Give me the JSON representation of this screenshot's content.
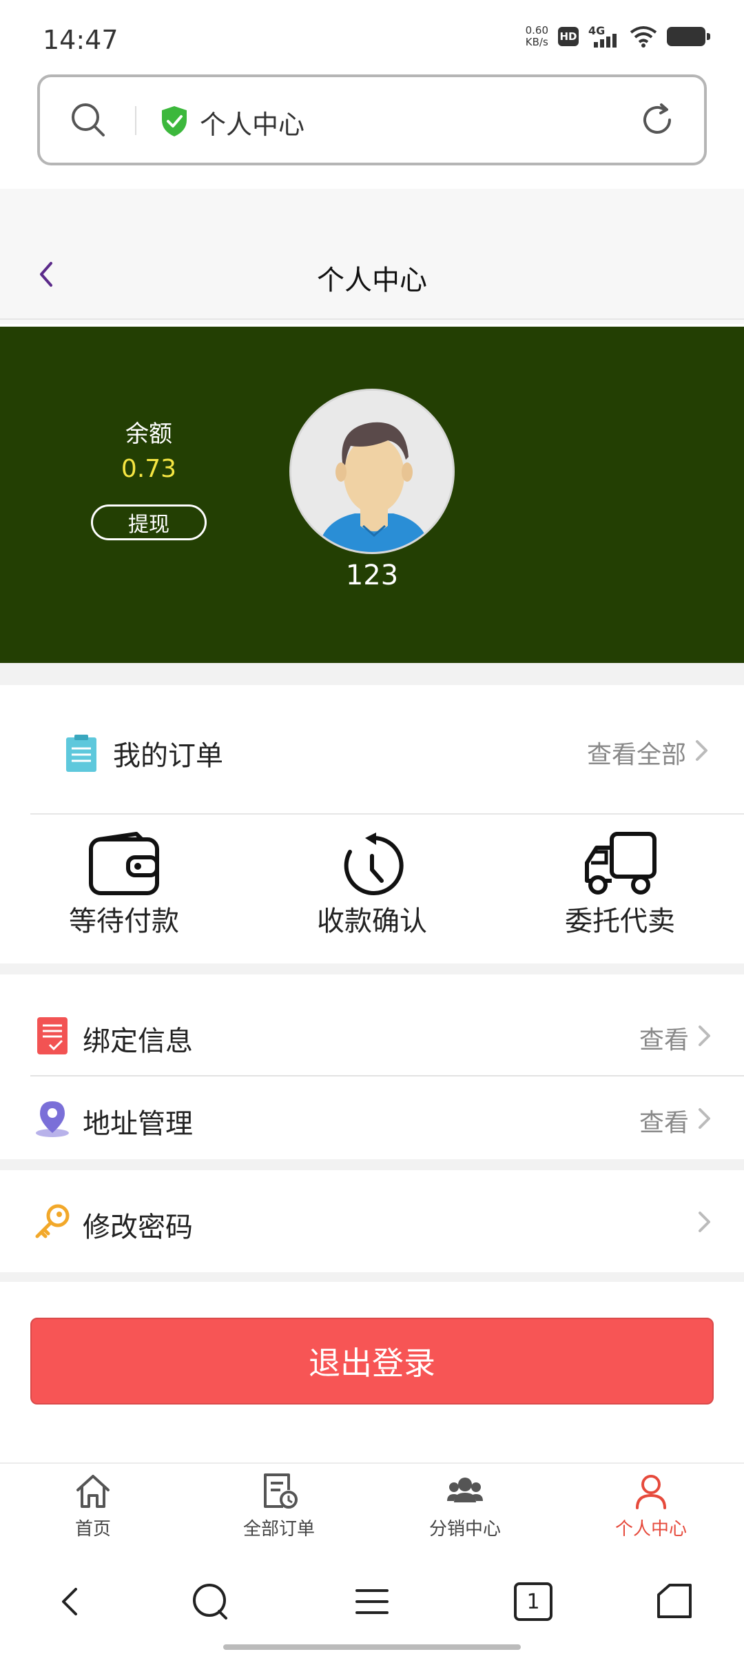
{
  "status_bar": {
    "time": "14:47",
    "net_speed_value": "0.60",
    "net_speed_unit": "KB/s",
    "hd": "HD",
    "network": "4G"
  },
  "browser": {
    "url_title": "个人中心"
  },
  "header": {
    "title": "个人中心"
  },
  "profile": {
    "balance_label": "余额",
    "balance_value": "0.73",
    "withdraw_label": "提现",
    "username": "123",
    "banner_color": "#233f03",
    "balance_color": "#f5e642"
  },
  "orders": {
    "title": "我的订单",
    "view_all": "查看全部",
    "items": [
      {
        "label": "等待付款",
        "icon": "wallet-icon"
      },
      {
        "label": "收款确认",
        "icon": "clock-icon"
      },
      {
        "label": "委托代卖",
        "icon": "truck-icon"
      }
    ]
  },
  "menu": {
    "bind_info": {
      "label": "绑定信息",
      "action": "查看",
      "icon": "checklist-icon"
    },
    "address": {
      "label": "地址管理",
      "action": "查看",
      "icon": "location-pin-icon"
    },
    "password": {
      "label": "修改密码",
      "icon": "key-icon"
    }
  },
  "logout": {
    "label": "退出登录",
    "color": "#f75555"
  },
  "tabs": [
    {
      "label": "首页",
      "icon": "home-icon",
      "active": false
    },
    {
      "label": "全部订单",
      "icon": "order-list-icon",
      "active": false
    },
    {
      "label": "分销中心",
      "icon": "group-icon",
      "active": false
    },
    {
      "label": "个人中心",
      "icon": "person-icon",
      "active": true
    }
  ],
  "system_nav": {
    "tab_count": "1"
  },
  "colors": {
    "accent_red": "#e64a3c",
    "header_back": "#5b2a8a"
  }
}
